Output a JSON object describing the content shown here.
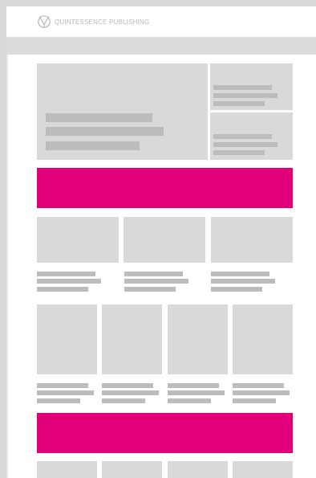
{
  "brand": {
    "name": "QUINTESSENCE PUBLISHING"
  },
  "colors": {
    "accent": "#e2007a",
    "placeholder": "#d9d9d9",
    "text_line": "#bcbcbc",
    "frame": "#d9d9d9"
  },
  "icons": {
    "logo": "quintessence-logo-icon"
  }
}
